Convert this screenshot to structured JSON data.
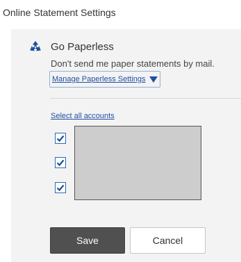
{
  "page": {
    "title": "Online Statement Settings"
  },
  "paperless": {
    "icon": "recycle-icon",
    "heading": "Go Paperless",
    "description": "Don't send me paper statements by mail.",
    "manage_label": "Manage Paperless Settings",
    "manage_icon": "triangle-down-icon"
  },
  "accounts": {
    "select_all_label": "Select all accounts",
    "checkboxes": [
      {
        "checked": true
      },
      {
        "checked": true
      },
      {
        "checked": true
      }
    ]
  },
  "actions": {
    "save_label": "Save",
    "cancel_label": "Cancel"
  },
  "colors": {
    "link": "#1f4fa3",
    "recycle_icon": "#1a4f9c",
    "save_bg": "#505050",
    "panel_bg": "#f3f3f3",
    "masked_area": "#cdcdcd"
  }
}
